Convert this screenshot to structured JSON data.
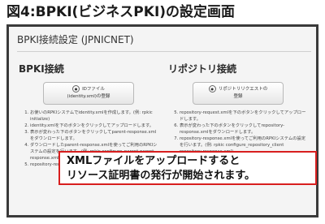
{
  "figure_title": "図4:BPKI(ビジネスPKI)の設定画面",
  "panel": {
    "title": "BPKI接続設定 (JPNICNET)"
  },
  "left": {
    "heading": "BPKI接続",
    "button_icon": "info-circle-icon",
    "button_line1": "IDファイル",
    "button_line2": "(identity.xml)の登録",
    "steps": [
      "お使いのRPKIシステムでidentity.xmlを作成します。(例: rpkic initialize)",
      "identity.xmlを下のボタンをクリックしてアップロードします。",
      "表示が変わった下のボタンをクリックしてparent-response.xmlをダウンロードします。",
      "ダウンロードしたparent-response.xmlを使ってご利用のRPKIシステムの設定を行います。(例: rpkic configure_parent parent-response.xml)",
      "repository-request.xml..."
    ]
  },
  "right": {
    "heading": "リポジトリ接続",
    "button_line1": "リポジトリリクエストの",
    "button_line2": "登録",
    "steps": [
      "repository-request.xmlを下のボタンをクリックしてアップロードします。",
      "表示が変わった下のボタンをクリックしてrepository-response.xmlをダウンロードします。",
      "repository-response.xmlを使ってご利用のRPKIシステムの設定を行います。(例: rpkic configure_repository_client repository-response.xml)"
    ]
  },
  "callout": {
    "line1": "XMLファイルをアップロードすると",
    "line2": "リソース証明書の発行が開始されます。"
  }
}
